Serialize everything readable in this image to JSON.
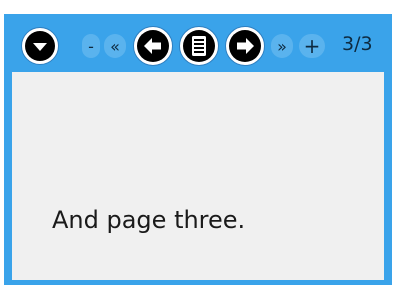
{
  "toolbar": {
    "menu_icon": "chevron-down-icon",
    "zoom_out_label": "-",
    "first_page_label": "«",
    "prev_icon": "arrow-left-icon",
    "pages_icon": "page-list-icon",
    "next_icon": "arrow-right-icon",
    "last_page_label": "»",
    "zoom_in_label": "+",
    "page_counter": "3/3"
  },
  "page": {
    "text": "And page three."
  },
  "colors": {
    "toolbar_background": "#3aa3ea",
    "content_background": "#f0f0f0",
    "button_background": "#ffffff",
    "icon_color": "#000000"
  }
}
